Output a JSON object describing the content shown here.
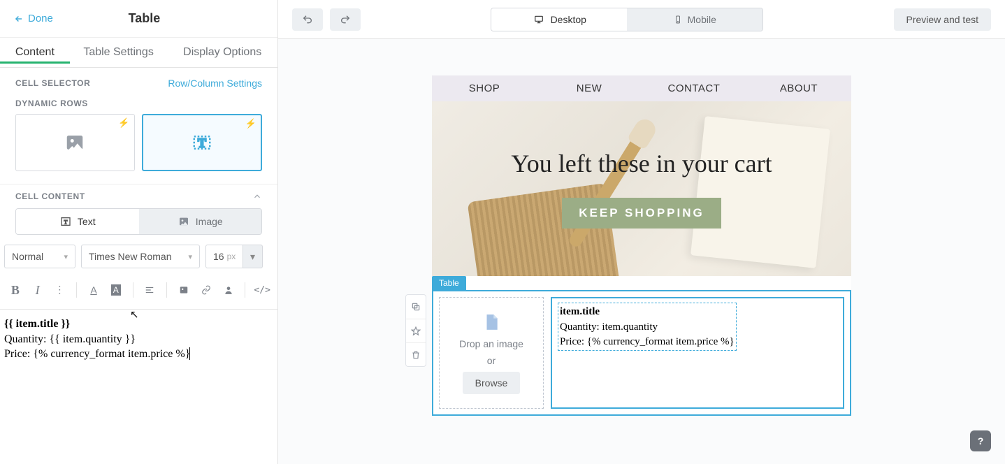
{
  "header": {
    "back": "Done",
    "title": "Table"
  },
  "tabs": [
    "Content",
    "Table Settings",
    "Display Options"
  ],
  "cell_selector": {
    "label": "CELL SELECTOR",
    "link": "Row/Column Settings"
  },
  "dynamic_rows_label": "DYNAMIC ROWS",
  "cell_content": {
    "label": "CELL CONTENT",
    "text_btn": "Text",
    "image_btn": "Image"
  },
  "format": {
    "style": "Normal",
    "font": "Times New Roman",
    "size": "16",
    "unit": "px"
  },
  "editor_lines": {
    "l1": "{{ item.title }}",
    "l2": "Quantity: {{ item.quantity }}",
    "l3": "Price: {% currency_format item.price %}"
  },
  "topbar": {
    "desktop": "Desktop",
    "mobile": "Mobile",
    "preview": "Preview and test"
  },
  "email": {
    "nav": [
      "SHOP",
      "NEW",
      "CONTACT",
      "ABOUT"
    ],
    "hero_title": "You left these in your cart",
    "hero_cta": "KEEP SHOPPING",
    "table_label": "Table",
    "drop_text": "Drop an image",
    "or": "or",
    "browse": "Browse",
    "preview_l1": "item.title",
    "preview_l2": "Quantity: item.quantity",
    "preview_l3": "Price: {% currency_format item.price %}"
  },
  "colors": {
    "accent": "#3eabda",
    "green": "#26b36f",
    "cta": "#9bad86"
  }
}
